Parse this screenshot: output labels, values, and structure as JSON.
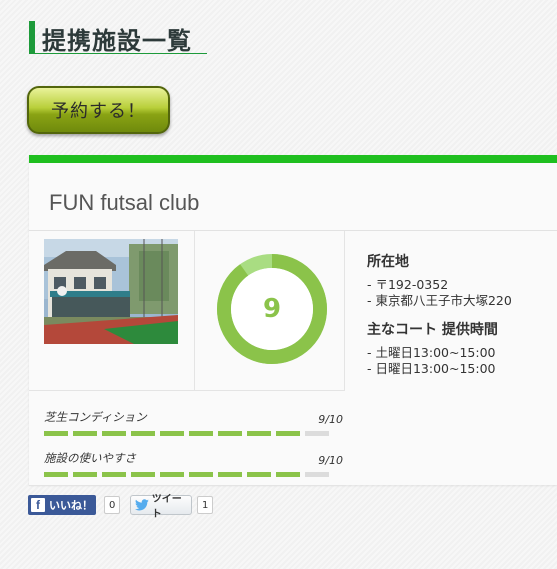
{
  "page": {
    "title": "提携施設一覧"
  },
  "reserve": {
    "label": "予約する！"
  },
  "facility": {
    "name": "FUN futsal club",
    "score": "9",
    "score_fraction": 0.9,
    "location_heading": "所在地",
    "location_lines": [
      "- 〒192-0352",
      "- 東京都八王子市大塚220"
    ],
    "court_heading": "主なコート 提供時間",
    "court_lines": [
      "- 土曜日13:00~15:00",
      "- 日曜日13:00~15:00"
    ],
    "ratings": [
      {
        "label": "芝生コンディション",
        "value_text": "9/10",
        "value": 9,
        "max": 10
      },
      {
        "label": "施設の使いやすさ",
        "value_text": "9/10",
        "value": 9,
        "max": 10
      }
    ]
  },
  "social": {
    "facebook_label": "いいね！",
    "facebook_count": "0",
    "twitter_label": "ツイート",
    "twitter_count": "1"
  },
  "colors": {
    "accent_green": "#1fbf1f",
    "score_green": "#8bc34a",
    "facebook_blue": "#3b5998"
  },
  "icons": [
    "facebook-icon",
    "twitter-icon"
  ]
}
